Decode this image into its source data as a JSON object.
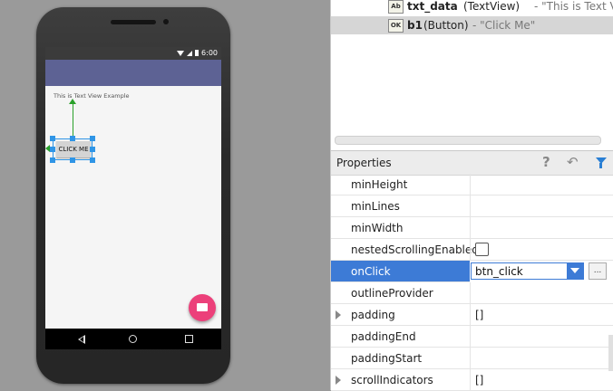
{
  "preview": {
    "status_time": "6:00",
    "text_view": "This is Text View Example",
    "button_label": "CLICK ME",
    "accent_color": "#5d6294",
    "fab_color": "#ec407a"
  },
  "tree": {
    "rows": [
      {
        "icon": "Ab",
        "name": "txt_data",
        "type": "(TextView)",
        "value": "- \"This is Text View Exa"
      },
      {
        "icon": "OK",
        "name": "b1",
        "type": "(Button)",
        "value": "- \"Click Me\""
      }
    ]
  },
  "properties": {
    "title": "Properties",
    "selection_color": "#3d7bd6",
    "rows": [
      {
        "name": "minHeight",
        "value": ""
      },
      {
        "name": "minLines",
        "value": ""
      },
      {
        "name": "minWidth",
        "value": ""
      },
      {
        "name": "nestedScrollingEnabled",
        "value": ""
      },
      {
        "name": "onClick",
        "value": "btn_click"
      },
      {
        "name": "outlineProvider",
        "value": ""
      },
      {
        "name": "padding",
        "value": "[]"
      },
      {
        "name": "paddingEnd",
        "value": ""
      },
      {
        "name": "paddingStart",
        "value": ""
      },
      {
        "name": "scrollIndicators",
        "value": "[]"
      }
    ],
    "ellipsis_label": "..."
  }
}
